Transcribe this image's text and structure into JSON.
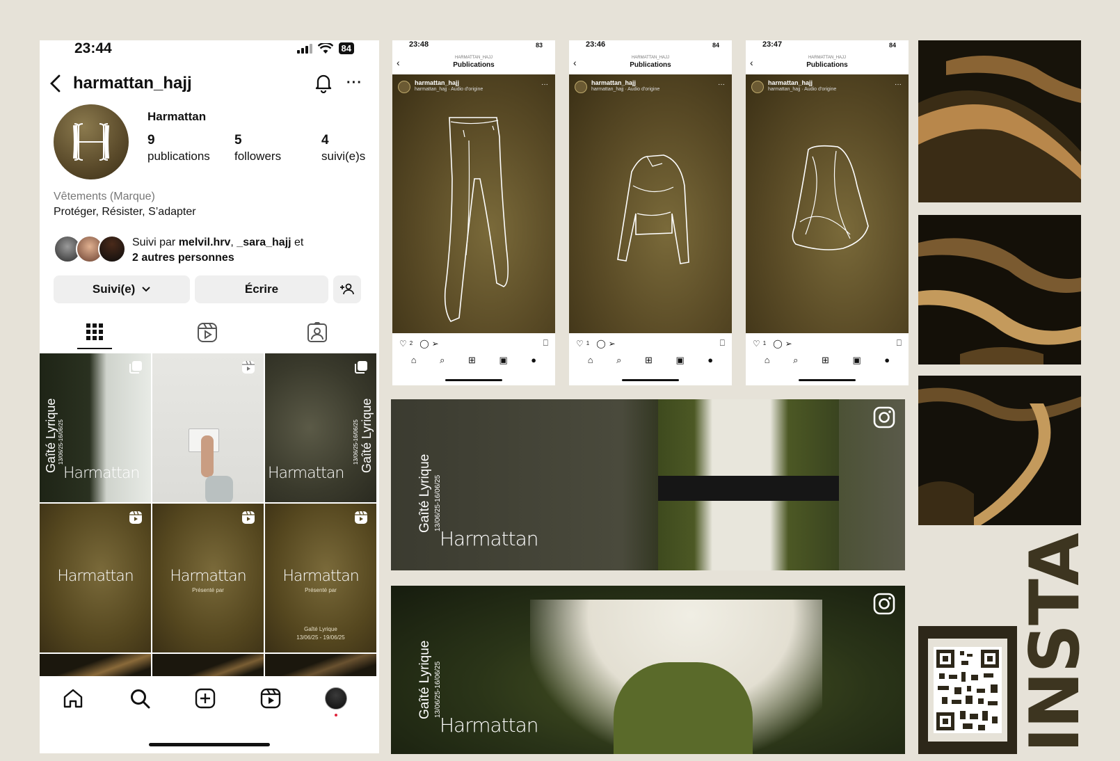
{
  "profile": {
    "status_time": "23:44",
    "battery": "84",
    "username": "harmattan_hajj",
    "display_name": "Harmattan",
    "stats": [
      {
        "num": "9",
        "label": "publications"
      },
      {
        "num": "5",
        "label": "followers"
      },
      {
        "num": "4",
        "label": "suivi(e)s"
      }
    ],
    "category": "Vêtements (Marque)",
    "bio": "Protéger, Résister, S’adapter",
    "followed_prefix": "Suivi par ",
    "followed_user1": "melvil.hrv",
    "followed_sep": ", ",
    "followed_user2": "_sara_hajj",
    "followed_and": " et",
    "followed_others": "2 autres personnes",
    "follow_button": "Suivi(e)",
    "write_button": "Écrire"
  },
  "grid": {
    "brand": "Harmattan",
    "venue": "Gaîté Lyrique",
    "dates": "13/06/25-16/06/25",
    "presented_by": "Présenté par",
    "tile9_venue": "Gaîté Lyrique",
    "tile9_dates": "13/06/25 - 19/06/25"
  },
  "minis": [
    {
      "time": "23:48",
      "battery": "83",
      "account": "HARMATTAN_HAJJ",
      "title": "Publications",
      "user": "harmattan_hajj",
      "audio": "harmattan_hajj · Audio d'origine",
      "likes": "2",
      "garment": "pants"
    },
    {
      "time": "23:46",
      "battery": "84",
      "account": "HARMATTAN_HAJJ",
      "title": "Publications",
      "user": "harmattan_hajj",
      "audio": "harmattan_hajj · Audio d'origine",
      "likes": "1",
      "garment": "top"
    },
    {
      "time": "23:47",
      "battery": "84",
      "account": "HARMATTAN_HAJJ",
      "title": "Publications",
      "user": "harmattan_hajj",
      "audio": "harmattan_hajj · Audio d'origine",
      "likes": "1",
      "garment": "hood"
    }
  ],
  "banners": [
    {
      "venue": "Gaîté Lyrique",
      "dates": "13/06/25-16/06/25",
      "brand": "Harmattan"
    },
    {
      "venue": "Gaîté Lyrique",
      "dates": "13/06/25-16/06/25",
      "brand": "Harmattan"
    }
  ],
  "insta_label": "INSTA",
  "colors": {
    "bg": "#e6e2d8",
    "olive": "#5a4b26",
    "dune_dark": "#1b170d",
    "dune_light": "#c49a5c"
  }
}
